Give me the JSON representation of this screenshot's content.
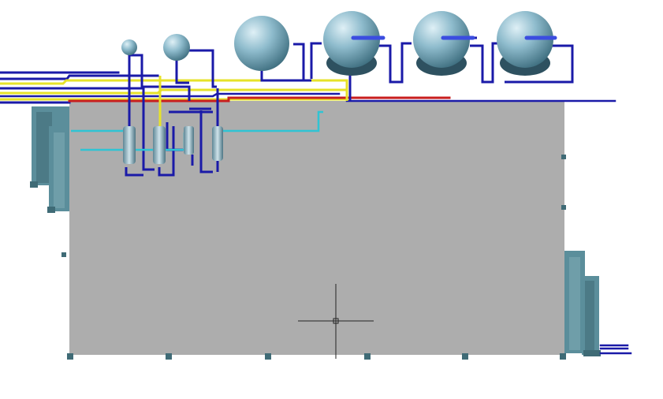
{
  "colors": {
    "background": "#ffffff",
    "floor_slab": "#adadad",
    "process_pipe": "#1a1aa8",
    "process_pipe_light": "#3b4de0",
    "steam_pipe": "#e6e22a",
    "hot_pipe": "#c81e1e",
    "cooling_pipe": "#2fc4d4",
    "vessel_body": "#88b3c4",
    "vessel_shadow": "#3d6b7a",
    "structure": "#5b8e9b",
    "crosshair": "#222222"
  },
  "icons": {
    "cursor": "crosshair-pickbox-icon"
  }
}
